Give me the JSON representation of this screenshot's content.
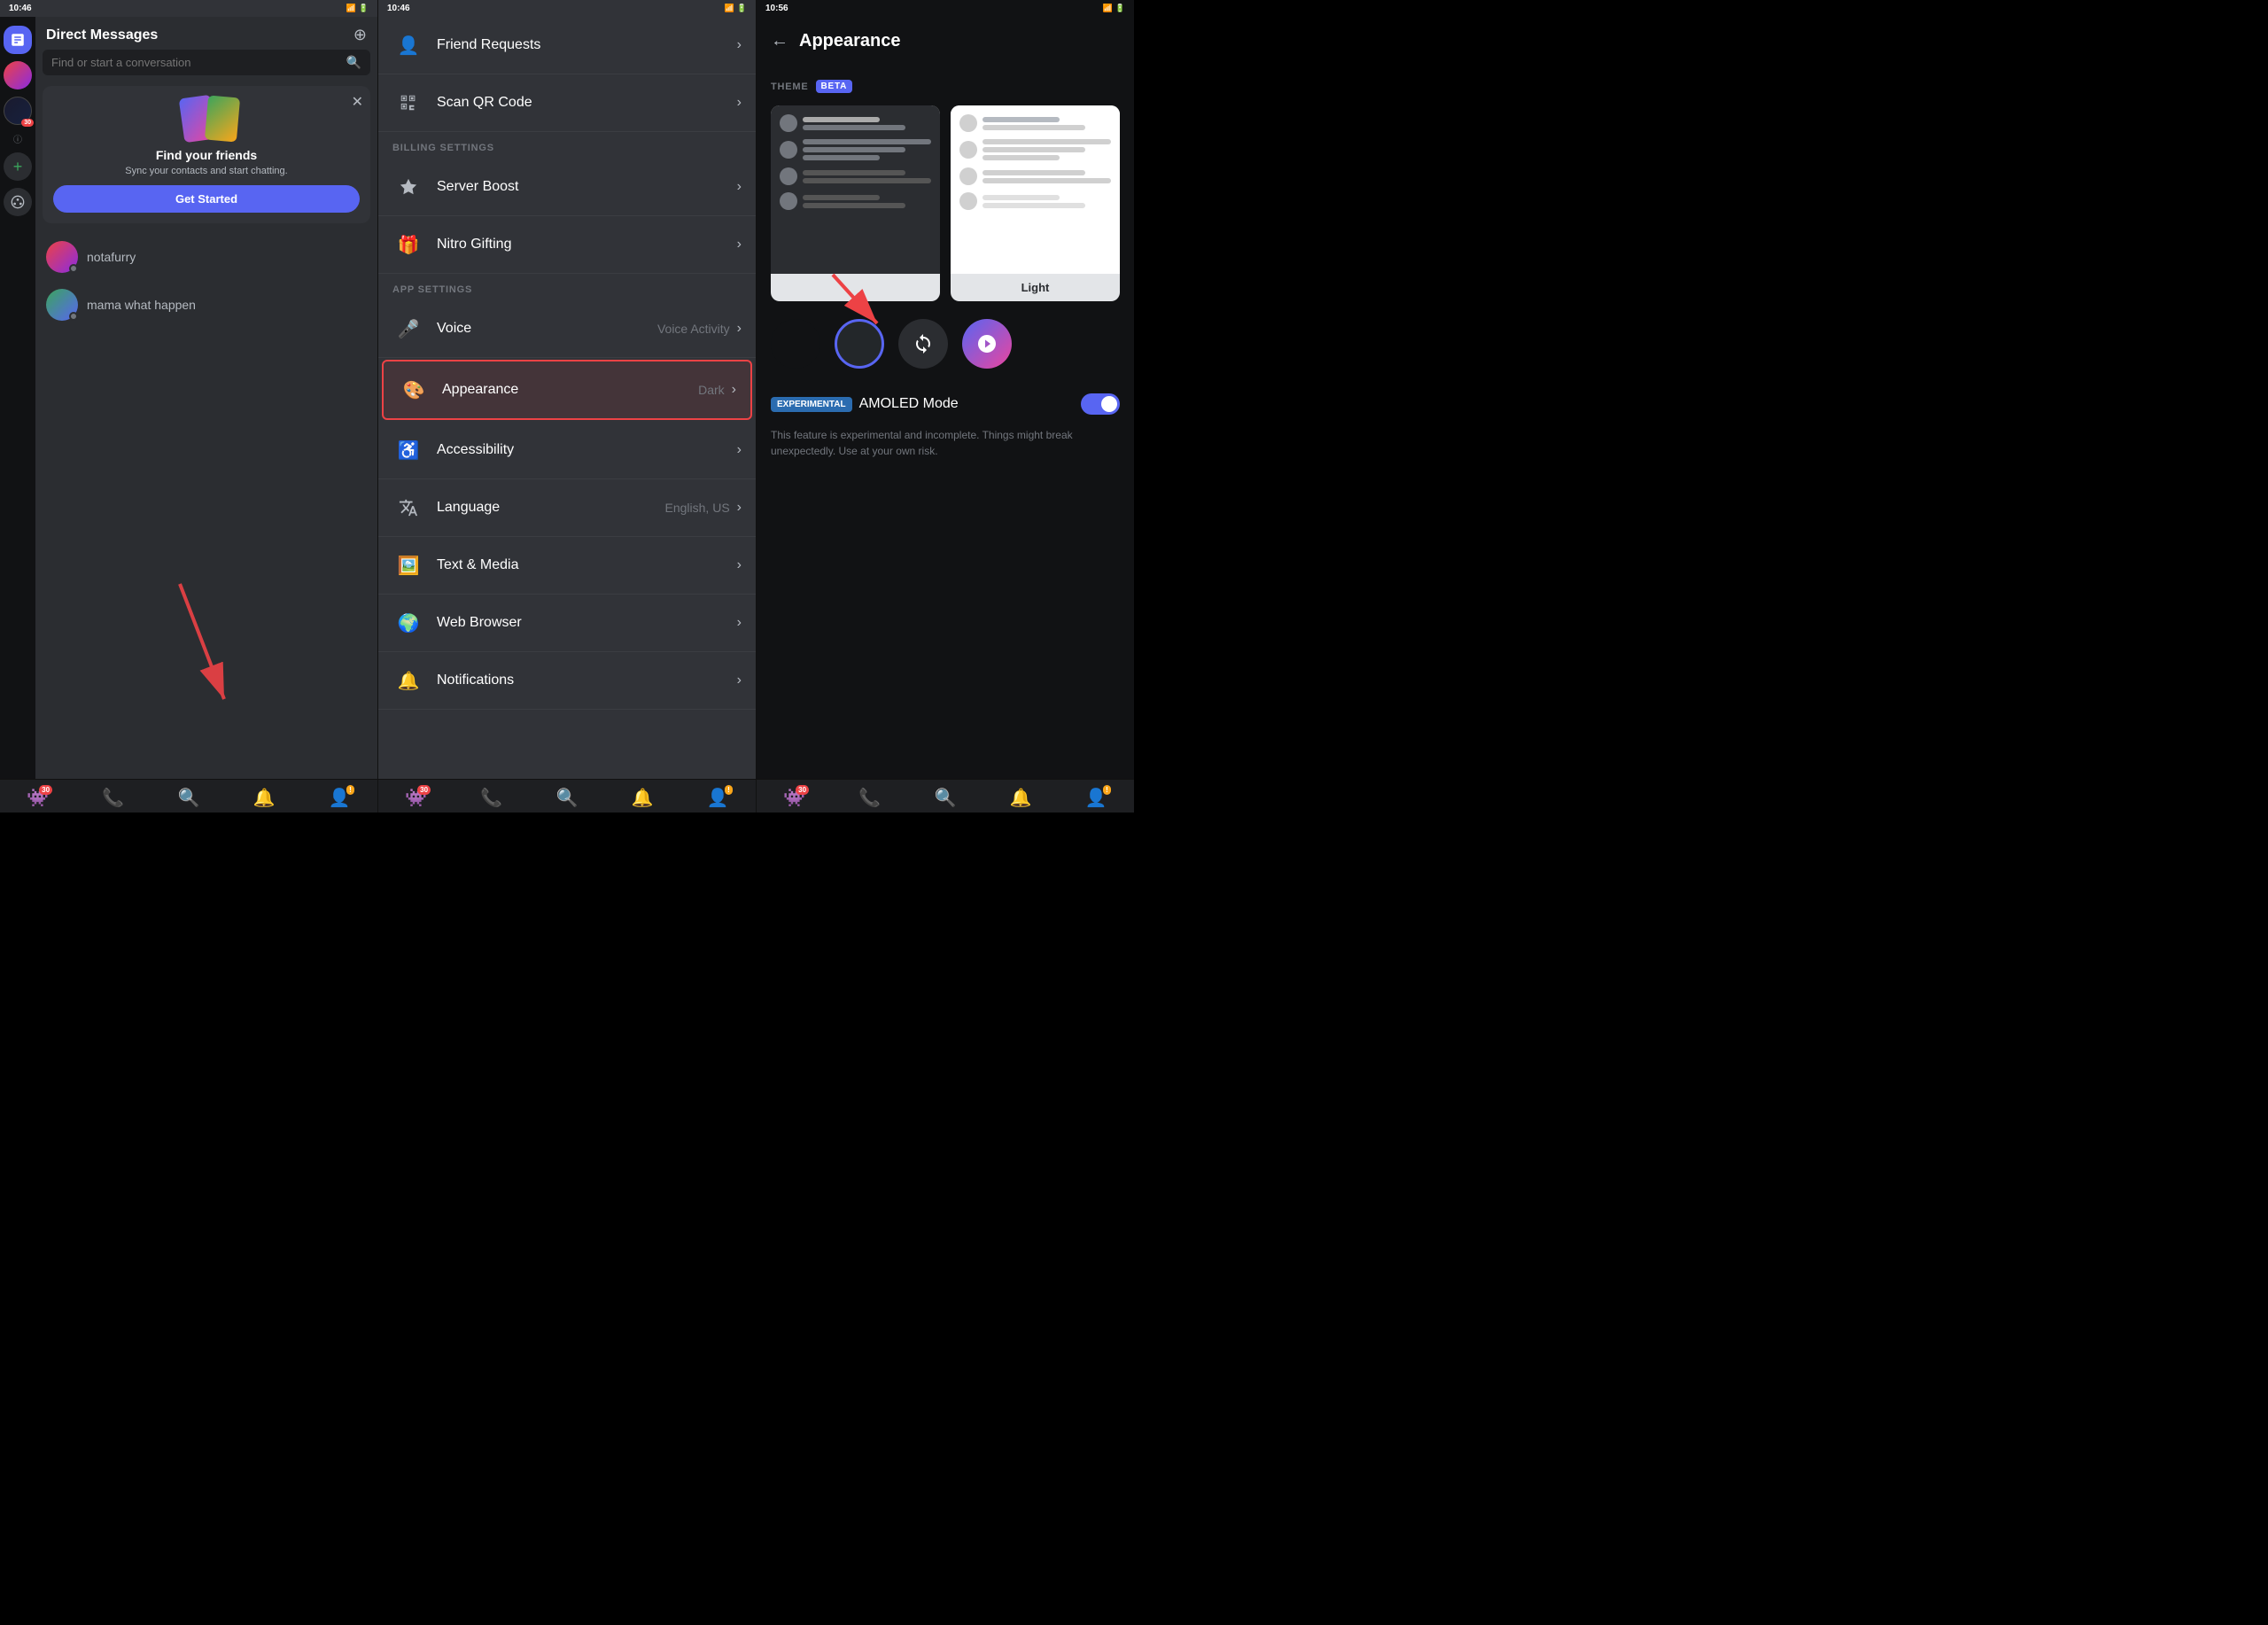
{
  "panel1": {
    "status_bar": {
      "time": "10:46",
      "right_icons": "📶🔋"
    },
    "header": {
      "title": "Direct Messages",
      "new_dm_icon": "🔲"
    },
    "search": {
      "placeholder": "Find or start a conversation"
    },
    "find_friends": {
      "title": "Find your friends",
      "subtitle": "Sync your contacts and start chatting.",
      "button": "Get Started"
    },
    "dm_items": [
      {
        "name": "notafurry",
        "avatar_style": "dm-avatar-1"
      },
      {
        "name": "mama what happen",
        "avatar_style": "dm-avatar-2"
      }
    ],
    "bottom_nav": [
      {
        "icon": "👾",
        "badge": "30",
        "name": "friends-nav"
      },
      {
        "icon": "📞",
        "badge": null,
        "name": "voice-nav"
      },
      {
        "icon": "🔍",
        "badge": null,
        "name": "search-nav"
      },
      {
        "icon": "🔔",
        "badge": null,
        "name": "notifications-nav"
      },
      {
        "icon": "👤",
        "badge": "!",
        "badge_color": "yellow",
        "name": "profile-nav"
      }
    ]
  },
  "panel2": {
    "status_bar": {
      "time": "10:46"
    },
    "billing_header": "BILLING SETTINGS",
    "app_header": "APP SETTINGS",
    "items": [
      {
        "icon": "👤",
        "label": "Friend Requests",
        "value": "",
        "name": "friend-requests-item"
      },
      {
        "icon": "⬛",
        "label": "Scan QR Code",
        "value": "",
        "name": "scan-qr-item"
      },
      {
        "icon": "🛡️",
        "label": "Server Boost",
        "value": "",
        "name": "server-boost-item",
        "section": "billing"
      },
      {
        "icon": "🎁",
        "label": "Nitro Gifting",
        "value": "",
        "name": "nitro-gifting-item"
      },
      {
        "icon": "🎤",
        "label": "Voice",
        "value": "Voice Activity",
        "name": "voice-item",
        "section": "app"
      },
      {
        "icon": "🎨",
        "label": "Appearance",
        "value": "Dark",
        "name": "appearance-item",
        "selected": true
      },
      {
        "icon": "♿",
        "label": "Accessibility",
        "value": "",
        "name": "accessibility-item"
      },
      {
        "icon": "🌐",
        "label": "Language",
        "value": "English, US",
        "name": "language-item"
      },
      {
        "icon": "🖼️",
        "label": "Text & Media",
        "value": "",
        "name": "text-media-item"
      },
      {
        "icon": "🌍",
        "label": "Web Browser",
        "value": "",
        "name": "web-browser-item"
      },
      {
        "icon": "🔔",
        "label": "Notifications",
        "value": "",
        "name": "notifications-item"
      }
    ],
    "bottom_nav": [
      {
        "icon": "👾",
        "badge": "30",
        "name": "friends-nav2"
      },
      {
        "icon": "📞",
        "badge": null,
        "name": "voice-nav2"
      },
      {
        "icon": "🔍",
        "badge": null,
        "name": "search-nav2"
      },
      {
        "icon": "🔔",
        "badge": null,
        "name": "notifications-nav2"
      },
      {
        "icon": "👤",
        "badge": "!",
        "badge_color": "yellow",
        "name": "profile-nav2"
      }
    ]
  },
  "panel3": {
    "status_bar": {
      "time": "10:56"
    },
    "header": {
      "back_icon": "←",
      "title": "Appearance"
    },
    "theme_section": {
      "label": "THEME",
      "beta_badge": "BETA"
    },
    "themes": [
      {
        "name": "dark-theme",
        "label": "",
        "selected": false
      },
      {
        "name": "light-theme",
        "label": "Light",
        "selected": false
      }
    ],
    "color_options": [
      {
        "name": "dark-color",
        "type": "dark"
      },
      {
        "name": "selected-color",
        "type": "selected"
      },
      {
        "name": "sync-color",
        "type": "sync",
        "icon": "🔄"
      },
      {
        "name": "nitro-color",
        "type": "nitro",
        "icon": "🎯"
      }
    ],
    "amoled": {
      "experimental_label": "EXPERIMENTAL",
      "label": "AMOLED Mode",
      "enabled": true,
      "description": "This feature is experimental and incomplete. Things might break unexpectedly. Use at your own risk."
    },
    "bottom_nav": [
      {
        "icon": "👾",
        "badge": "30",
        "name": "friends-nav3"
      },
      {
        "icon": "📞",
        "badge": null,
        "name": "voice-nav3"
      },
      {
        "icon": "🔍",
        "badge": null,
        "name": "search-nav3"
      },
      {
        "icon": "🔔",
        "badge": null,
        "name": "notifications-nav3"
      },
      {
        "icon": "👤",
        "badge": "!",
        "badge_color": "yellow",
        "name": "profile-nav3"
      }
    ]
  }
}
